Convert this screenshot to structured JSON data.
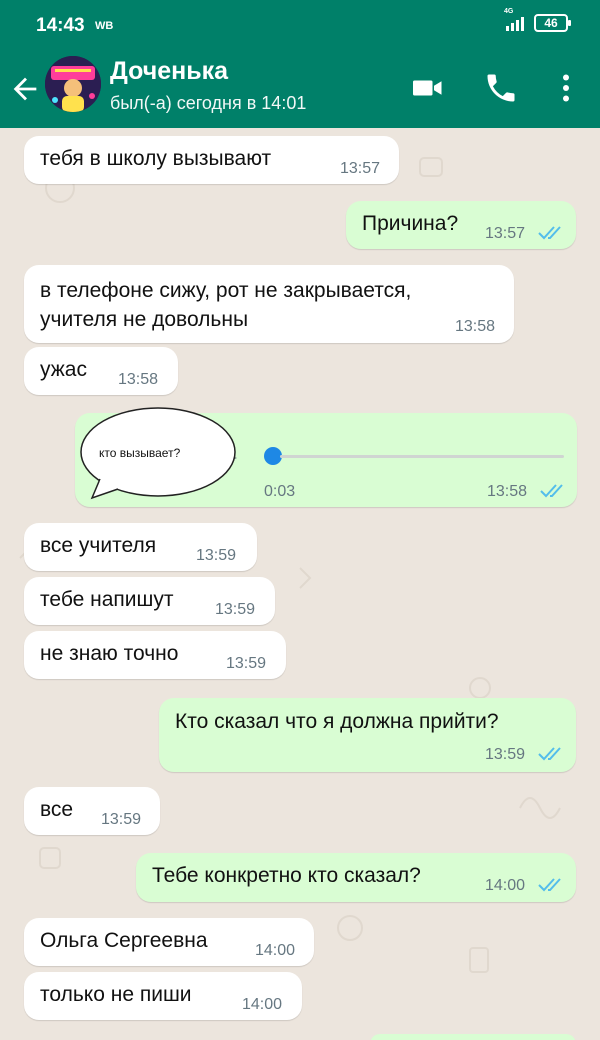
{
  "status_bar": {
    "time": "14:43",
    "carrier": "WB",
    "network": "4G",
    "battery": "46"
  },
  "header": {
    "contact_name": "Доченька",
    "last_seen": "был(-а) сегодня в 14:01"
  },
  "colors": {
    "header": "#008069",
    "incoming": "#ffffff",
    "outgoing": "#d9fdd3",
    "read_ticks": "#53bdeb",
    "chat_bg": "#ece5dd"
  },
  "messages": [
    {
      "dir": "in",
      "text": "тебя в школу вызывают",
      "time": "13:57"
    },
    {
      "dir": "out",
      "text": "Причина?",
      "time": "13:57",
      "status": "read"
    },
    {
      "dir": "in",
      "text": "в телефоне сижу, рот не закрывается,\nучителя не довольны",
      "time": "13:58"
    },
    {
      "dir": "in",
      "text": "ужас",
      "time": "13:58"
    },
    {
      "dir": "out",
      "type": "voice",
      "duration": "0:03",
      "time": "13:58",
      "status": "read",
      "overlay_label": "кто вызывает?"
    },
    {
      "dir": "in",
      "text": "все учителя",
      "time": "13:59"
    },
    {
      "dir": "in",
      "text": "тебе напишут",
      "time": "13:59"
    },
    {
      "dir": "in",
      "text": "не знаю точно",
      "time": "13:59"
    },
    {
      "dir": "out",
      "text": "Кто сказал что я должна прийти?",
      "time": "13:59",
      "status": "read"
    },
    {
      "dir": "in",
      "text": "все",
      "time": "13:59"
    },
    {
      "dir": "out",
      "text": "Тебе конкретно кто сказал?",
      "time": "14:00",
      "status": "read"
    },
    {
      "dir": "in",
      "text": "Ольга Сергеевна",
      "time": "14:00"
    },
    {
      "dir": "in",
      "text": "только не пиши",
      "time": "14:00"
    }
  ]
}
